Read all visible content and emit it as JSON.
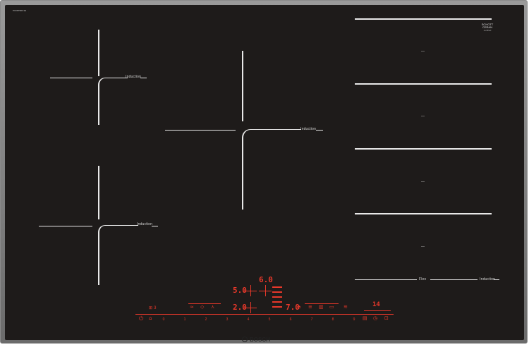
{
  "model_code": "PXV875DC1E",
  "zones": {
    "left_top": {
      "label": "Induction"
    },
    "center": {
      "label": "Induction"
    },
    "left_bottom": {
      "label": "Induction"
    },
    "flex_zone": {
      "label": "Induction",
      "combine_label": "Flex"
    }
  },
  "flex_markers": [
    "—",
    "—",
    "—",
    "—"
  ],
  "schott": {
    "line1": "SCHOTT",
    "line2": "CERAN",
    "line3": "certified"
  },
  "display": {
    "zone_top_value": "6.0",
    "zone_left_value": "5.0",
    "zone_lower_value": "2.0",
    "zone_right_value": "7.0",
    "timer_value": "14",
    "misc_label": "⊞ 3"
  },
  "power_scale": [
    "0",
    "1",
    "2",
    "3",
    "4",
    "5",
    "6",
    "7",
    "8",
    "9"
  ],
  "icons": {
    "power": "power-icon",
    "child_lock": "child-lock-icon",
    "wipe_protect": "wipe-protect-icon",
    "powerboost": "powerboost-icon",
    "fry_sensor": "fry-sensor-icon",
    "timer": "timer-icon",
    "wifi": "wifi-icon",
    "clock": "clock-icon"
  },
  "brand": {
    "name": "BOSCH"
  },
  "colors": {
    "accent": "#e8382a",
    "glass": "#1e1b1a",
    "frame": "#8a8a8a"
  }
}
